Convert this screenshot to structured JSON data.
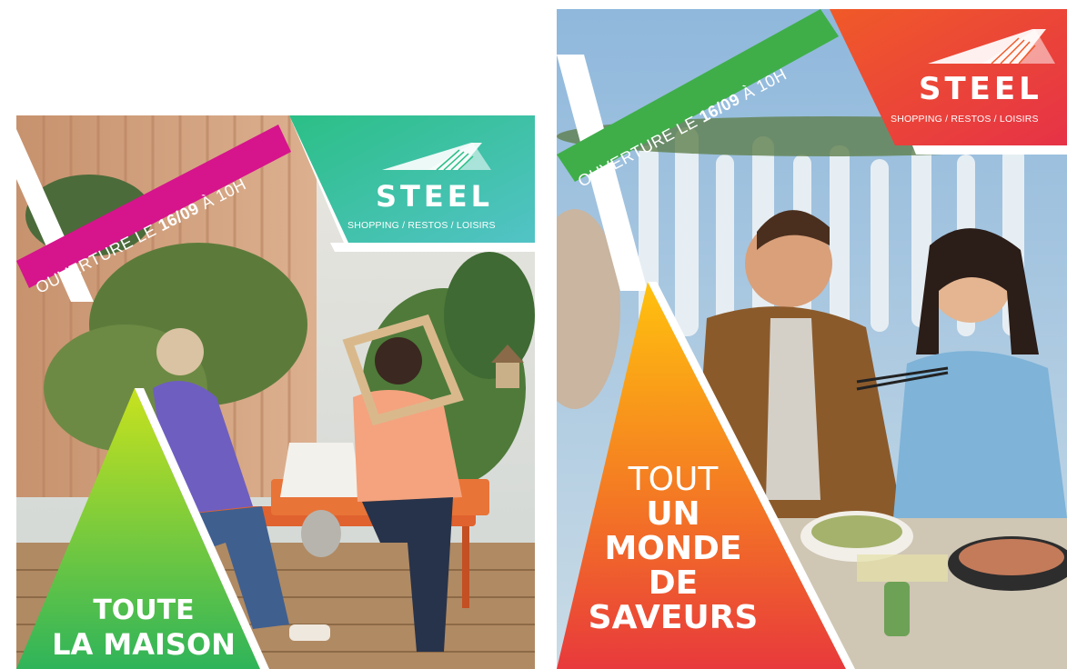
{
  "posters": [
    {
      "id": "home",
      "opening": {
        "prefix": "OUVERTURE LE ",
        "date": "16/09",
        "suffix": " À 10H",
        "color": "#d6148c"
      },
      "brand": {
        "name": "STEEL",
        "tagline": "SHOPPING / RESTOS / LOISIRS",
        "colors": [
          "#2bbf86",
          "#52c3c6"
        ]
      },
      "headline": {
        "lines": [
          "TOUTE",
          "LA MAISON"
        ],
        "colors": [
          "#c8e21e",
          "#2fb45a"
        ]
      }
    },
    {
      "id": "food",
      "opening": {
        "prefix": "OUVERTURE LE ",
        "date": "16/09",
        "suffix": " À 10H",
        "color": "#3fae49"
      },
      "brand": {
        "name": "STEEL",
        "tagline": "SHOPPING / RESTOS / LOISIRS",
        "colors": [
          "#f05a28",
          "#e63247"
        ]
      },
      "headline": {
        "lines": [
          "TOUT",
          "UN",
          "MONDE",
          "DE",
          "SAVEURS"
        ],
        "colors": [
          "#ffc20e",
          "#e8393c"
        ]
      }
    }
  ]
}
